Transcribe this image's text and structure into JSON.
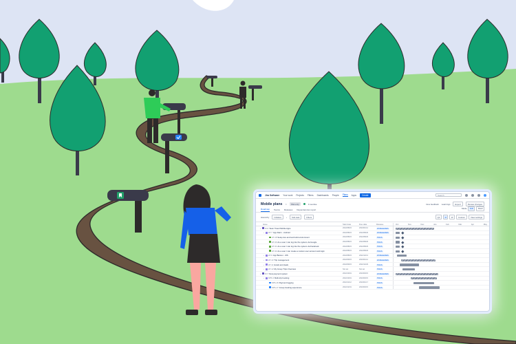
{
  "app": {
    "brand": "Jira Software",
    "nav": [
      "Your work",
      "Projects",
      "Filters",
      "Dashboards",
      "People",
      "Plans",
      "Apps"
    ],
    "active_nav": "Plans",
    "create_label": "Create",
    "search_placeholder": "Search"
  },
  "plan": {
    "title": "Mobile plans",
    "badge": "Plan-only",
    "status": "3 overdue",
    "actions": [
      "Give feedback",
      "Learnings",
      "Export",
      "Review changes"
    ]
  },
  "tabs": [
    "Roadmap",
    "Teams",
    "Releases",
    "Dependencies report"
  ],
  "active_tab": "Roadmap",
  "view_toggle": {
    "label": "Mode",
    "options": [
      "Edit",
      "Read"
    ]
  },
  "controls": {
    "hierarchy_label": "Hierarchy",
    "hierarchy_from": "Initiative",
    "hierarchy_to": "Sub-task",
    "filters_label": "Filters",
    "zoom_options": [
      "Qtr",
      "M",
      "W"
    ],
    "zoom_selected": "M",
    "custom_label": "Custom",
    "view_settings_label": "View settings"
  },
  "columns": {
    "issue": "Issue",
    "fields": "Fields",
    "start": "Start date",
    "due": "Due date",
    "release": "Release",
    "months": [
      "Oct",
      "Nov",
      "Dec",
      "Jan",
      "Feb",
      "Mar",
      "Apr",
      "May"
    ]
  },
  "rows": [
    {
      "key": "IO-6",
      "summary": "Team Travel Mobile Apps",
      "type": "init",
      "indent": 0,
      "start": "2022/08/15",
      "due": "2023/01/12",
      "release": "26 RELEASES"
    },
    {
      "key": "HT-7",
      "summary": "App Alarm - Android",
      "type": "epic",
      "indent": 1,
      "start": "2022/08/15",
      "due": "2022/08/29",
      "release": "26 RELEASES"
    },
    {
      "key": "HT-18",
      "summary": "Setup dev and test build environment",
      "type": "story",
      "indent": 2,
      "start": "2022/08/15",
      "due": "2022/08/29",
      "release": "TIRUS"
    },
    {
      "key": "HT-30",
      "summary": "As a user I can log into the system via Google",
      "type": "story",
      "indent": 2,
      "start": "2022/08/15",
      "due": "2022/08/29",
      "release": "TIRUS"
    },
    {
      "key": "HT-31",
      "summary": "As a user I can log into the system via Facebook",
      "type": "story",
      "indent": 2,
      "start": "2022/08/15",
      "due": "2022/08/29",
      "release": "TIRUS"
    },
    {
      "key": "HT-32",
      "summary": "As a user I can create a custom user account and login",
      "type": "story",
      "indent": 2,
      "start": "2022/08/15",
      "due": "2022/08/29",
      "release": "TIRUS"
    },
    {
      "key": "HT-9",
      "summary": "App Banner - iOS",
      "type": "epic",
      "indent": 1,
      "start": "2022/08/15",
      "due": "2022/12/13",
      "release": "26 RELEASES"
    },
    {
      "key": "HT-10",
      "summary": "Trip management",
      "type": "epic",
      "indent": 1,
      "start": "2022/09/15",
      "due": "2023/01/12",
      "release": "26 RELEASES"
    },
    {
      "key": "HT-11",
      "summary": "Hotels and deals",
      "type": "epic",
      "indent": 1,
      "start": "2022/09/15",
      "due": "2022/12/29",
      "release": "TIRUS"
    },
    {
      "key": "HT-12",
      "summary": "My Group Trips Overview",
      "type": "epic",
      "indent": 1,
      "start": "Not set",
      "due": "Not set",
      "release": "TIRUS"
    },
    {
      "key": "IO-7",
      "summary": "New payment system",
      "type": "init",
      "indent": 0,
      "start": "2022/10/01",
      "due": "2023/03/15",
      "release": "26 RELEASES"
    },
    {
      "key": "NPS-3",
      "summary": "Multi-trip booking",
      "type": "epic",
      "indent": 1,
      "start": "2022/10/01",
      "due": "2023/03/15",
      "release": "TIRUS"
    },
    {
      "key": "NPS-16",
      "summary": "Payment logging",
      "type": "task",
      "indent": 2,
      "start": "2022/11/12",
      "due": "2023/01/17",
      "release": "TIRUS"
    },
    {
      "key": "NPS-17",
      "summary": "Group booking experience",
      "type": "task",
      "indent": 2,
      "start": "2022/12/01",
      "due": "2023/03/15",
      "release": "TIRUS"
    }
  ],
  "colors": {
    "sky": "#dfe6f6",
    "grass": "#9ddb8d",
    "path": "#66503f",
    "tree": "#13a070",
    "jira_blue": "#0c66e4"
  }
}
